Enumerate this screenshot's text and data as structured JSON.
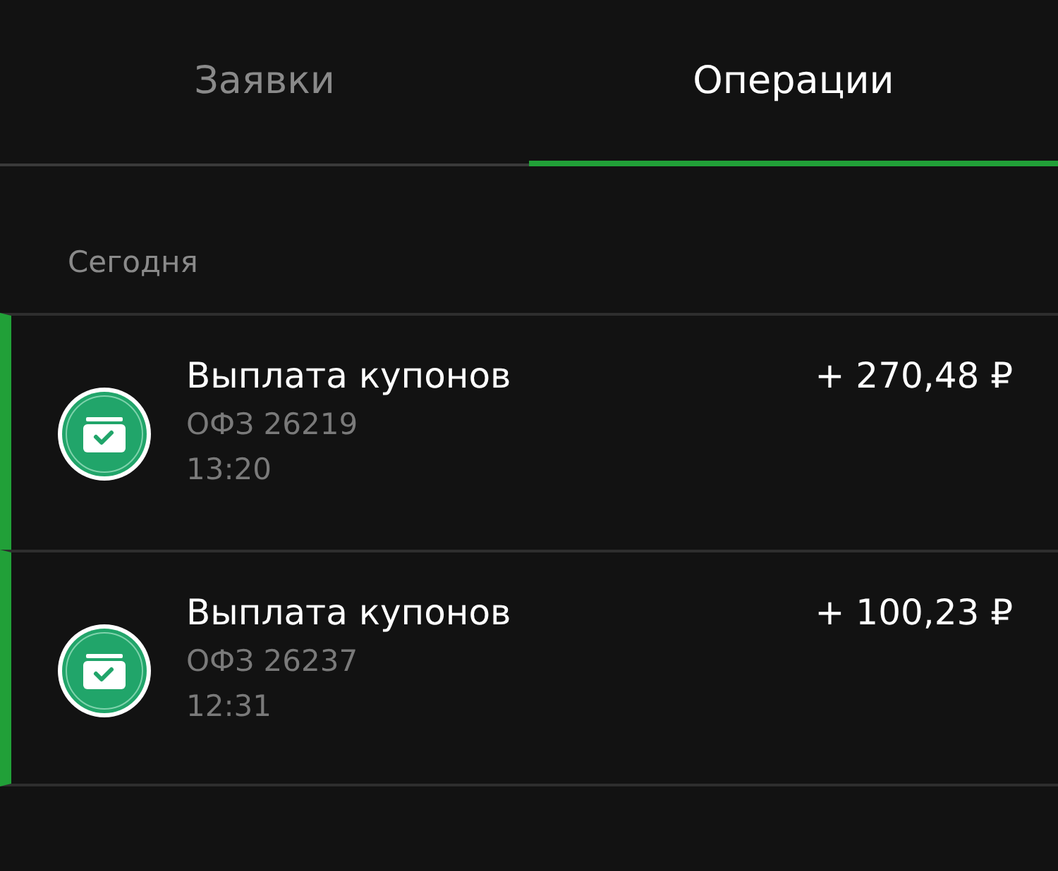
{
  "tabs": [
    {
      "label": "Заявки",
      "selected": false
    },
    {
      "label": "Операции",
      "selected": true
    }
  ],
  "section": {
    "title": "Сегодня"
  },
  "operations": [
    {
      "title": "Выплата купонов",
      "security": "ОФЗ 26219",
      "time": "13:20",
      "amount": "+ 270,48 ₽",
      "highlighted": true
    },
    {
      "title": "Выплата купонов",
      "security": "ОФЗ 26237",
      "time": "12:31",
      "amount": "+ 100,23 ₽",
      "highlighted": true
    }
  ]
}
